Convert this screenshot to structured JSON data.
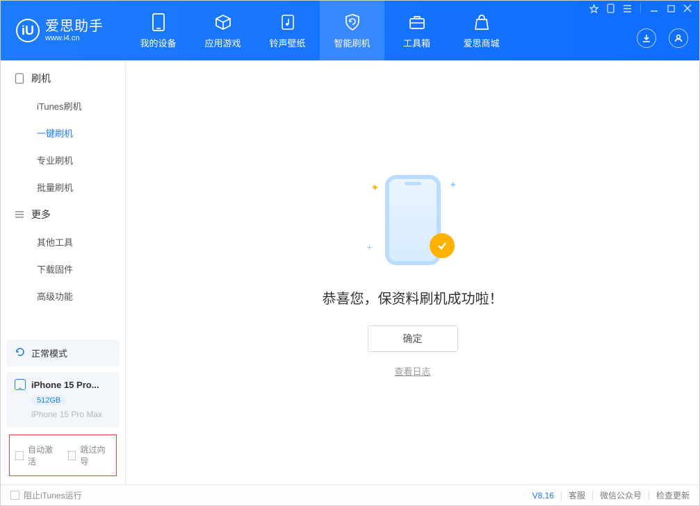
{
  "app": {
    "name": "爱思助手",
    "url": "www.i4.cn",
    "logo_letter": "iU"
  },
  "nav": {
    "items": [
      {
        "id": "device",
        "label": "我的设备"
      },
      {
        "id": "apps",
        "label": "应用游戏"
      },
      {
        "id": "ringtone",
        "label": "铃声壁纸"
      },
      {
        "id": "flash",
        "label": "智能刷机",
        "active": true
      },
      {
        "id": "toolbox",
        "label": "工具箱"
      },
      {
        "id": "store",
        "label": "爱思商城"
      }
    ]
  },
  "sidebar": {
    "group1": {
      "title": "刷机",
      "items": [
        {
          "label": "iTunes刷机"
        },
        {
          "label": "一键刷机",
          "active": true
        },
        {
          "label": "专业刷机"
        },
        {
          "label": "批量刷机"
        }
      ]
    },
    "group2": {
      "title": "更多",
      "items": [
        {
          "label": "其他工具"
        },
        {
          "label": "下载固件"
        },
        {
          "label": "高级功能"
        }
      ]
    },
    "mode": "正常模式",
    "device": {
      "name": "iPhone 15 Pro...",
      "storage": "512GB",
      "model": "iPhone 15 Pro Max"
    },
    "highlight_checks": {
      "auto_activate": "自动激活",
      "skip_guide": "跳过向导"
    }
  },
  "main": {
    "success": "恭喜您，保资料刷机成功啦！",
    "ok": "确定",
    "view_log": "查看日志"
  },
  "footer": {
    "block_itunes": "阻止iTunes运行",
    "version": "V8.16",
    "support": "客服",
    "wechat": "微信公众号",
    "update": "检查更新"
  }
}
